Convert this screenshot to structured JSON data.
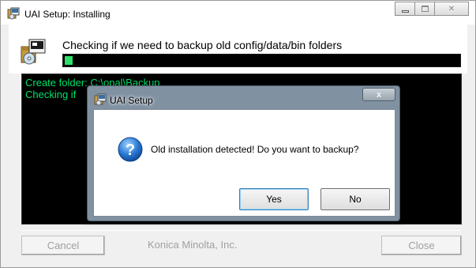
{
  "window": {
    "title": "UAI Setup: Installing",
    "controls": {
      "minimize_icon": "minimize-icon",
      "maximize_icon": "maximize-icon",
      "close_icon": "close-icon"
    }
  },
  "header": {
    "status": "Checking if we need to backup old config/data/bin folders",
    "progress_percent": 2
  },
  "log": {
    "lines": [
      "Create folder: C:\\opal\\Backup",
      "Checking if"
    ]
  },
  "footer": {
    "cancel_label": "Cancel",
    "company": "Konica Minolta, Inc.",
    "close_label": "Close"
  },
  "dialog": {
    "title": "UAI Setup",
    "close_glyph": "x",
    "message": "Old installation detected! Do you want to backup?",
    "icon": "question-icon",
    "yes_label": "Yes",
    "no_label": "No"
  },
  "colors": {
    "progress": "#2de06a",
    "log_text": "#00e06a",
    "log_bg": "#000000"
  }
}
